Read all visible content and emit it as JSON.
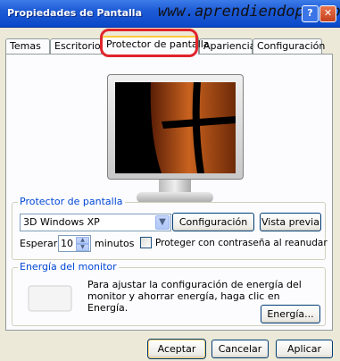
{
  "window": {
    "title": "Propiedades de Pantalla",
    "watermark": "www.aprendiendopc.com",
    "help_glyph": "?",
    "close_glyph": "✕"
  },
  "tabs": [
    {
      "label": "Temas"
    },
    {
      "label": "Escritorio"
    },
    {
      "label": "Protector de pantalla",
      "active": true
    },
    {
      "label": "Apariencia"
    },
    {
      "label": "Configuración"
    }
  ],
  "screensaver": {
    "group_label": "Protector de pantalla",
    "selected": "3D Windows XP",
    "config_button": "Configuración",
    "preview_button": "Vista previa",
    "wait_label": "Esperar:",
    "wait_value": "10",
    "minutes_label": "minutos",
    "password_checkbox_label": "Proteger con contraseña al reanudar",
    "password_checked": false
  },
  "energy": {
    "group_label": "Energía del monitor",
    "description": "Para ajustar la configuración de energía del monitor y ahorrar energía, haga clic en Energía.",
    "button": "Energía..."
  },
  "footer": {
    "ok": "Aceptar",
    "cancel": "Cancelar",
    "apply": "Aplicar"
  },
  "colors": {
    "highlight": "#e0242b",
    "group_label": "#0046d5",
    "titlebar": "#1d5bd6"
  }
}
